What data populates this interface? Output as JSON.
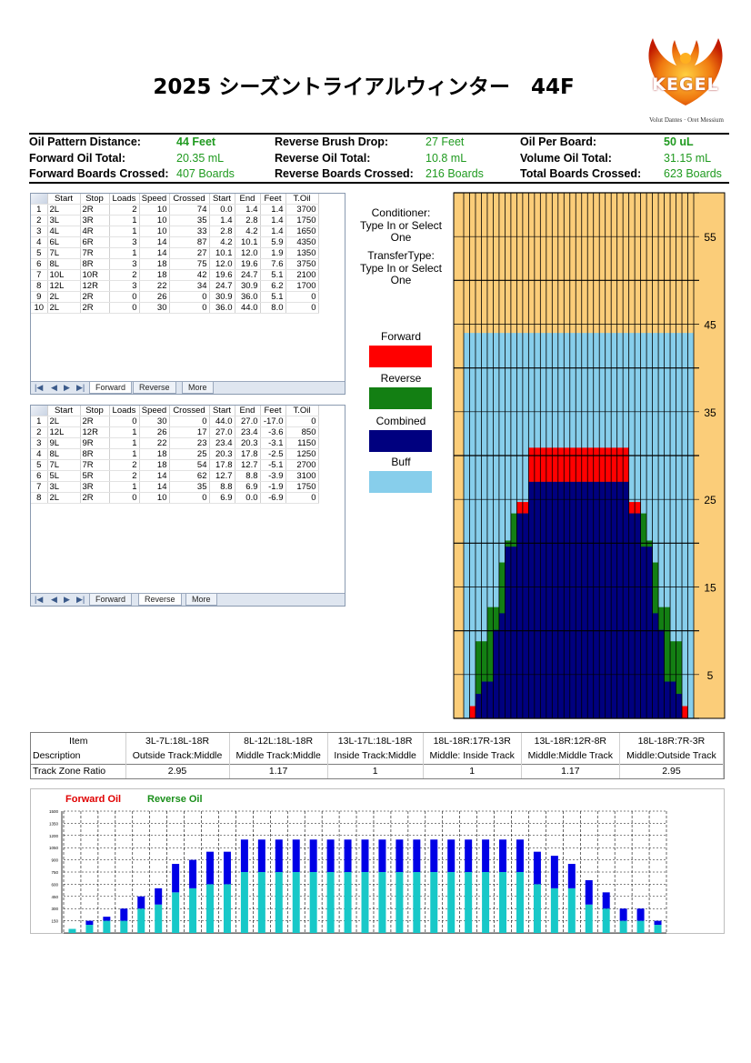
{
  "title": "2025 シーズントライアルウィンター　44F",
  "logo": {
    "word": "KEGEL",
    "tagline": "Volut Dantes · Oret Messium"
  },
  "summary": [
    [
      {
        "label": "Oil Pattern Distance:",
        "value": "44 Feet",
        "bold": true
      },
      {
        "label": "Reverse Brush Drop:",
        "value": "27 Feet",
        "bold": false
      },
      {
        "label": "Oil Per Board:",
        "value": "50 uL",
        "bold": true
      }
    ],
    [
      {
        "label": "Forward Oil Total:",
        "value": "20.35 mL",
        "bold": false
      },
      {
        "label": "Reverse Oil Total:",
        "value": "10.8 mL",
        "bold": false
      },
      {
        "label": "Volume Oil Total:",
        "value": "31.15 mL",
        "bold": false
      }
    ],
    [
      {
        "label": "Forward Boards Crossed:",
        "value": "407 Boards",
        "bold": false
      },
      {
        "label": "Reverse Boards Crossed:",
        "value": "216 Boards",
        "bold": false
      },
      {
        "label": "Total Boards Crossed:",
        "value": "623 Boards",
        "bold": false
      }
    ]
  ],
  "headers": [
    "Start",
    "Stop",
    "Loads",
    "Speed",
    "Crossed",
    "Start",
    "End",
    "Feet",
    "T.Oil"
  ],
  "forward_rows": [
    [
      "1",
      "2L",
      "2R",
      "2",
      "10",
      "74",
      "0.0",
      "1.4",
      "1.4",
      "3700"
    ],
    [
      "2",
      "3L",
      "3R",
      "1",
      "10",
      "35",
      "1.4",
      "2.8",
      "1.4",
      "1750"
    ],
    [
      "3",
      "4L",
      "4R",
      "1",
      "10",
      "33",
      "2.8",
      "4.2",
      "1.4",
      "1650"
    ],
    [
      "4",
      "6L",
      "6R",
      "3",
      "14",
      "87",
      "4.2",
      "10.1",
      "5.9",
      "4350"
    ],
    [
      "5",
      "7L",
      "7R",
      "1",
      "14",
      "27",
      "10.1",
      "12.0",
      "1.9",
      "1350"
    ],
    [
      "6",
      "8L",
      "8R",
      "3",
      "18",
      "75",
      "12.0",
      "19.6",
      "7.6",
      "3750"
    ],
    [
      "7",
      "10L",
      "10R",
      "2",
      "18",
      "42",
      "19.6",
      "24.7",
      "5.1",
      "2100"
    ],
    [
      "8",
      "12L",
      "12R",
      "3",
      "22",
      "34",
      "24.7",
      "30.9",
      "6.2",
      "1700"
    ],
    [
      "9",
      "2L",
      "2R",
      "0",
      "26",
      "0",
      "30.9",
      "36.0",
      "5.1",
      "0"
    ],
    [
      "10",
      "2L",
      "2R",
      "0",
      "30",
      "0",
      "36.0",
      "44.0",
      "8.0",
      "0"
    ]
  ],
  "reverse_rows": [
    [
      "1",
      "2L",
      "2R",
      "0",
      "30",
      "0",
      "44.0",
      "27.0",
      "-17.0",
      "0"
    ],
    [
      "2",
      "12L",
      "12R",
      "1",
      "26",
      "17",
      "27.0",
      "23.4",
      "-3.6",
      "850"
    ],
    [
      "3",
      "9L",
      "9R",
      "1",
      "22",
      "23",
      "23.4",
      "20.3",
      "-3.1",
      "1150"
    ],
    [
      "4",
      "8L",
      "8R",
      "1",
      "18",
      "25",
      "20.3",
      "17.8",
      "-2.5",
      "1250"
    ],
    [
      "5",
      "7L",
      "7R",
      "2",
      "18",
      "54",
      "17.8",
      "12.7",
      "-5.1",
      "2700"
    ],
    [
      "6",
      "5L",
      "5R",
      "2",
      "14",
      "62",
      "12.7",
      "8.8",
      "-3.9",
      "3100"
    ],
    [
      "7",
      "3L",
      "3R",
      "1",
      "14",
      "35",
      "8.8",
      "6.9",
      "-1.9",
      "1750"
    ],
    [
      "8",
      "2L",
      "2R",
      "0",
      "10",
      "0",
      "6.9",
      "0.0",
      "-6.9",
      "0"
    ]
  ],
  "tabs": {
    "forward": "Forward",
    "reverse": "Reverse",
    "more": "More"
  },
  "conditioner": {
    "line1": "Conditioner:",
    "line2": "Type In or Select",
    "line3": "One"
  },
  "transfer": {
    "line1": "TransferType:",
    "line2": "Type In or Select",
    "line3": "One"
  },
  "legend": [
    {
      "label": "Forward",
      "color": "#ff0000"
    },
    {
      "label": "Reverse",
      "color": "#137f13"
    },
    {
      "label": "Combined",
      "color": "#00007f"
    },
    {
      "label": "Buff",
      "color": "#87ceeb"
    }
  ],
  "lane_chart": {
    "type": "heatmap",
    "pattern_length_ft": 44,
    "lane_length_ft": 60,
    "feet_labels": [
      "55",
      "45",
      "35",
      "25",
      "15",
      "5"
    ],
    "feet_label_values": [
      55,
      45,
      35,
      25,
      15,
      5
    ],
    "boards_per_side": 19,
    "colors": {
      "background": "#fbcd79",
      "buff": "#87ceeb",
      "forward": "#ff0000",
      "reverse": "#137f13",
      "combined": "#00007f"
    },
    "forward_runs": [
      {
        "board": 2,
        "start": 0.0,
        "end": 1.4
      },
      {
        "board": 3,
        "start": 1.4,
        "end": 2.8
      },
      {
        "board": 4,
        "start": 2.8,
        "end": 4.2
      },
      {
        "board": 6,
        "start": 4.2,
        "end": 10.1
      },
      {
        "board": 7,
        "start": 10.1,
        "end": 12.0
      },
      {
        "board": 8,
        "start": 12.0,
        "end": 19.6
      },
      {
        "board": 10,
        "start": 19.6,
        "end": 24.7
      },
      {
        "board": 12,
        "start": 24.7,
        "end": 30.9
      }
    ],
    "reverse_runs": [
      {
        "board": 12,
        "start": 23.4,
        "end": 27.0
      },
      {
        "board": 9,
        "start": 20.3,
        "end": 23.4
      },
      {
        "board": 8,
        "start": 17.8,
        "end": 20.3
      },
      {
        "board": 7,
        "start": 12.7,
        "end": 17.8
      },
      {
        "board": 5,
        "start": 8.8,
        "end": 12.7
      },
      {
        "board": 3,
        "start": 6.9,
        "end": 8.8
      }
    ]
  },
  "zone_table": {
    "item_label": "Item",
    "desc_label": "Description",
    "ratio_label": "Track Zone Ratio",
    "zones": [
      {
        "item": "3L-7L:18L-18R",
        "desc": "Outside Track:Middle",
        "ratio": "2.95"
      },
      {
        "item": "8L-12L:18L-18R",
        "desc": "Middle Track:Middle",
        "ratio": "1.17"
      },
      {
        "item": "13L-17L:18L-18R",
        "desc": "Inside Track:Middle",
        "ratio": "1"
      },
      {
        "item": "18L-18R:17R-13R",
        "desc": "Middle: Inside Track",
        "ratio": "1"
      },
      {
        "item": "13L-18R:12R-8R",
        "desc": "Middle:Middle Track",
        "ratio": "1.17"
      },
      {
        "item": "18L-18R:7R-3R",
        "desc": "Middle:Outside Track",
        "ratio": "2.95"
      }
    ]
  },
  "bar_legend": {
    "forward": "Forward Oil",
    "reverse": "Reverse Oil",
    "forward_color": "#e00000",
    "reverse_color": "#1a8f1a"
  },
  "chart_data": {
    "type": "bar",
    "stacked": true,
    "ylim": [
      0,
      1500
    ],
    "y_ticks": [
      150,
      300,
      450,
      600,
      750,
      900,
      1050,
      1200,
      1350,
      1500
    ],
    "categories": [
      "2L",
      "3L",
      "4L",
      "5L",
      "6L",
      "7L",
      "8L",
      "9L",
      "10L",
      "11L",
      "12L",
      "13L",
      "14L",
      "15L",
      "16L",
      "17L",
      "18L",
      "19",
      "18R",
      "17R",
      "16R",
      "15R",
      "14R",
      "13R",
      "12R",
      "11R",
      "10R",
      "9R",
      "8R",
      "7R",
      "6R",
      "5R",
      "4R",
      "3R",
      "2R"
    ],
    "series": [
      {
        "color": "#18c8c8",
        "values": [
          50,
          100,
          150,
          150,
          300,
          350,
          500,
          550,
          600,
          600,
          750,
          750,
          750,
          750,
          750,
          750,
          750,
          750,
          750,
          750,
          750,
          750,
          750,
          750,
          750,
          750,
          750,
          600,
          550,
          550,
          350,
          300,
          150,
          150,
          100
        ]
      },
      {
        "color": "#0000e6",
        "values": [
          0,
          50,
          50,
          150,
          150,
          200,
          350,
          350,
          400,
          400,
          400,
          400,
          400,
          400,
          400,
          400,
          400,
          400,
          400,
          400,
          400,
          400,
          400,
          400,
          400,
          400,
          400,
          400,
          400,
          300,
          300,
          200,
          150,
          150,
          50
        ]
      }
    ]
  }
}
